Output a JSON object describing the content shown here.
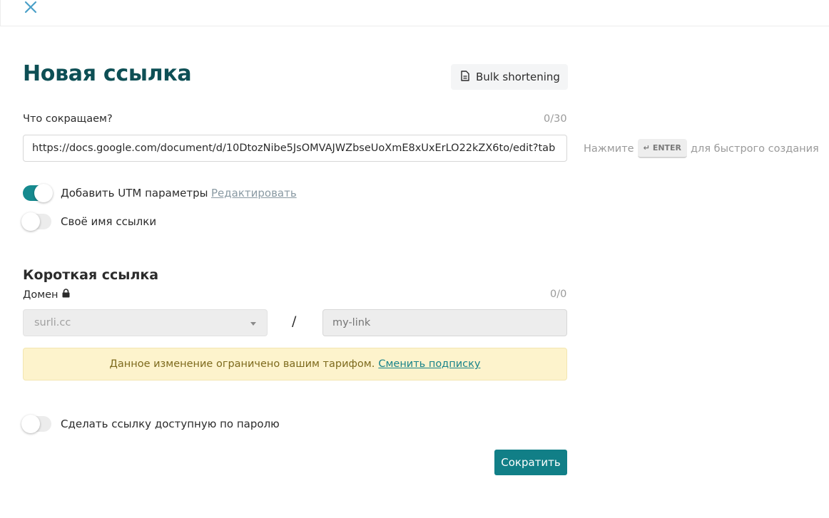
{
  "header": {
    "close_icon": "close-icon"
  },
  "form": {
    "title": "Новая ссылка",
    "bulk_button_label": "Bulk shortening",
    "bulk_button_icon": "document-icon",
    "url_label": "Что сокращаем?",
    "url_counter": "0/30",
    "url_value": "https://docs.google.com/document/d/10DtozNibe5JsOMVAJWZbseUoXmE8xUxErLO22kZX6to/edit?tab",
    "hint_prefix": "Нажмите",
    "hint_key": "ENTER",
    "hint_suffix": "для быстрого создания"
  },
  "options": {
    "utm_label": "Добавить UTM параметры",
    "utm_enabled": true,
    "utm_edit_link": "Редактировать",
    "custom_name_label": "Своё имя ссылки",
    "custom_name_enabled": false
  },
  "short_link": {
    "section_title": "Короткая ссылка",
    "domain_label": "Домен",
    "domain_counter": "0/0",
    "domain_value": "surli.cc",
    "slash": "/",
    "slug_placeholder": "my-link"
  },
  "notice": {
    "text": "Данное изменение ограничено вашим тарифом.",
    "link_text": "Сменить подписку"
  },
  "password": {
    "label": "Сделать ссылку доступную по паролю",
    "enabled": false
  },
  "actions": {
    "submit_label": "Сократить"
  },
  "colors": {
    "title": "#0d4f55",
    "accent": "#117f87",
    "toggle_on": "#168a8f",
    "notice_bg": "#fdf3cc"
  }
}
